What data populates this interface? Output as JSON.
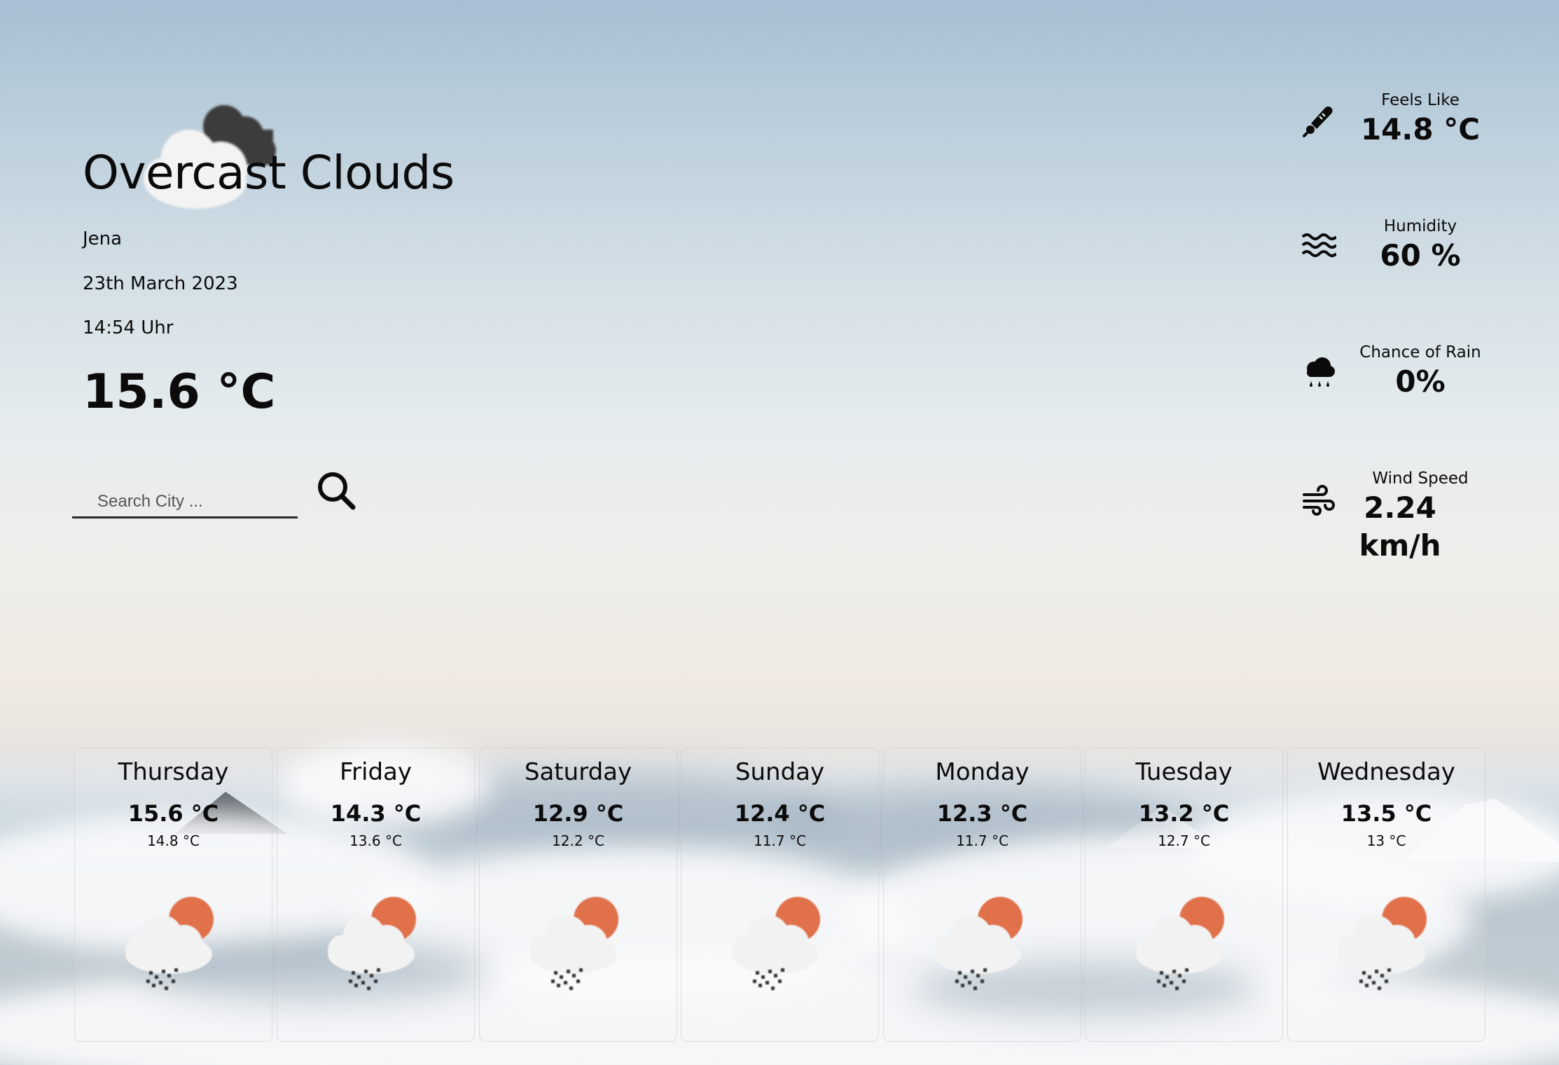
{
  "current": {
    "condition": "Overcast Clouds",
    "city": "Jena",
    "date": "23th March 2023",
    "time": "14:54 Uhr",
    "temperature": "15.6 °C",
    "icon": "overcast-clouds-icon"
  },
  "search": {
    "placeholder": "Search City ...",
    "icon": "search-icon"
  },
  "stats": {
    "feels_like": {
      "label": "Feels Like",
      "value": "14.8 °C",
      "icon": "thermometer-icon"
    },
    "humidity": {
      "label": "Humidity",
      "value": "60 %",
      "icon": "water-waves-icon"
    },
    "rain": {
      "label": "Chance of Rain",
      "value": "0%",
      "icon": "rain-cloud-icon"
    },
    "wind": {
      "label": "Wind Speed",
      "value": "2.24 km/h",
      "icon": "wind-icon"
    }
  },
  "forecast": [
    {
      "day": "Thursday",
      "max": "15.6 °C",
      "min": "14.8 °C",
      "icon": "sun-cloud-snow-icon"
    },
    {
      "day": "Friday",
      "max": "14.3 °C",
      "min": "13.6 °C",
      "icon": "sun-cloud-snow-icon"
    },
    {
      "day": "Saturday",
      "max": "12.9 °C",
      "min": "12.2 °C",
      "icon": "sun-cloud-snow-icon"
    },
    {
      "day": "Sunday",
      "max": "12.4 °C",
      "min": "11.7 °C",
      "icon": "sun-cloud-snow-icon"
    },
    {
      "day": "Monday",
      "max": "12.3 °C",
      "min": "11.7 °C",
      "icon": "sun-cloud-snow-icon"
    },
    {
      "day": "Tuesday",
      "max": "13.2 °C",
      "min": "12.7 °C",
      "icon": "sun-cloud-snow-icon"
    },
    {
      "day": "Wednesday",
      "max": "13.5 °C",
      "min": "13 °C",
      "icon": "sun-cloud-snow-icon"
    }
  ],
  "colors": {
    "sun": "#e0714a",
    "cloud": "#f2f2f2",
    "dark_cloud": "#3c3c3c",
    "text": "#0b0b0b"
  }
}
